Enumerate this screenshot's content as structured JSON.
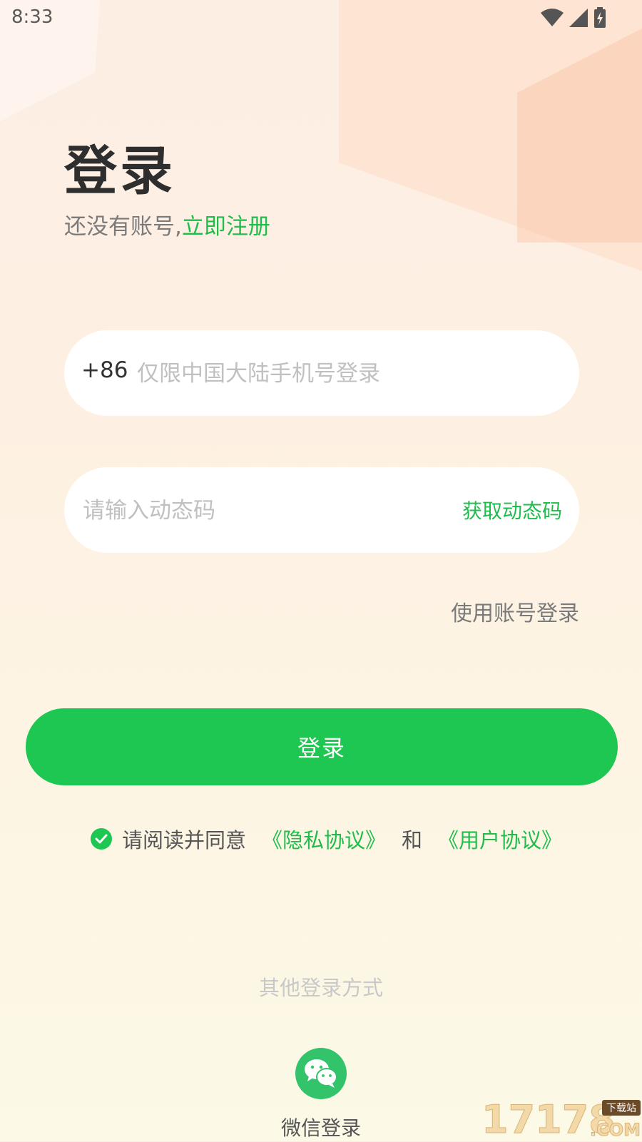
{
  "status_bar": {
    "time": "8:33"
  },
  "header": {
    "title": "登录",
    "no_account_text": "还没有账号,",
    "register_link": "立即注册"
  },
  "phone": {
    "prefix": "+86",
    "placeholder": "仅限中国大陆手机号登录"
  },
  "code": {
    "placeholder": "请输入动态码",
    "get_code_label": "获取动态码"
  },
  "account_login_label": "使用账号登录",
  "login_button_label": "登录",
  "agreement": {
    "prefix": "请阅读并同意",
    "privacy_link": "《隐私协议》",
    "and": "和",
    "user_link": "《用户协议》",
    "checked": true
  },
  "other_methods_label": "其他登录方式",
  "wechat": {
    "label": "微信登录",
    "icon": "wechat-icon"
  },
  "watermark": {
    "number": "17178",
    "tag": "下载站",
    "domain": ".COM"
  },
  "colors": {
    "accent": "#1ec752",
    "link": "#1fbe4c",
    "title": "#2e2e2e"
  }
}
